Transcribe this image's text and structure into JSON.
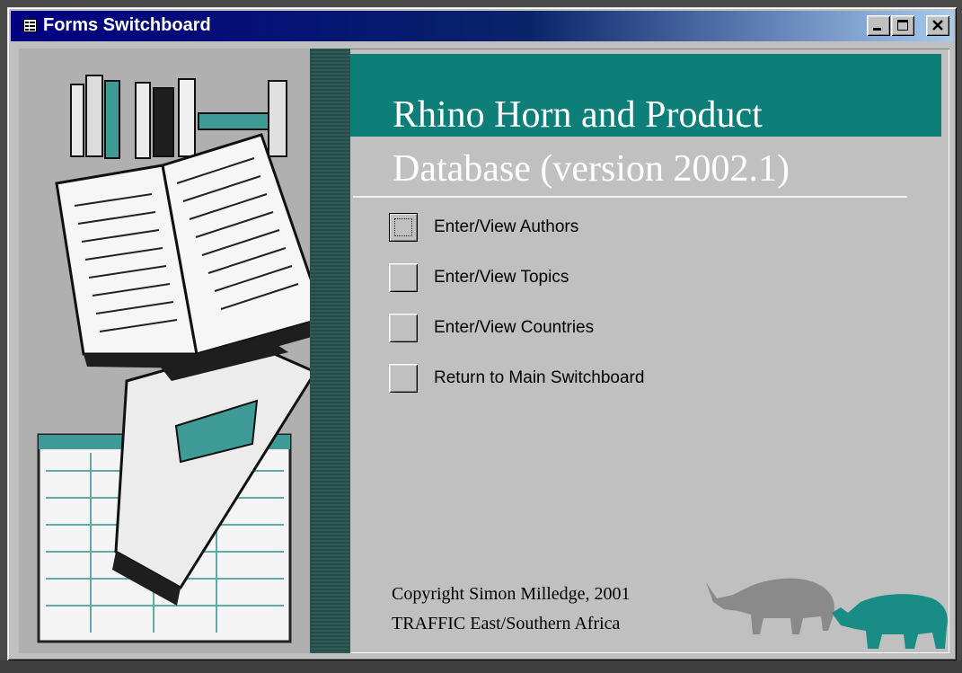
{
  "window": {
    "title": "Forms Switchboard",
    "controls": {
      "minimize": "minimize",
      "maximize": "maximize",
      "close": "close"
    }
  },
  "header": {
    "line1": "Rhino Horn and Product",
    "line2": "Database (version 2002.1)"
  },
  "switchboard": {
    "items": [
      {
        "label": "Enter/View Authors",
        "focused": true
      },
      {
        "label": "Enter/View Topics",
        "focused": false
      },
      {
        "label": "Enter/View Countries",
        "focused": false
      },
      {
        "label": "Return to Main Switchboard",
        "focused": false
      }
    ]
  },
  "footer": {
    "line1": "Copyright Simon Milledge, 2001",
    "line2": "TRAFFIC East/Southern Africa"
  },
  "colors": {
    "accent": "#0d7f78",
    "titlebar": "#000080",
    "face": "#c0c0c0",
    "rhino_grey": "#8a8a8a",
    "rhino_teal": "#1a8c86"
  },
  "icons": {
    "window_icon": "form-icon",
    "art": "books-illustration",
    "logo": "rhino-silhouettes"
  }
}
